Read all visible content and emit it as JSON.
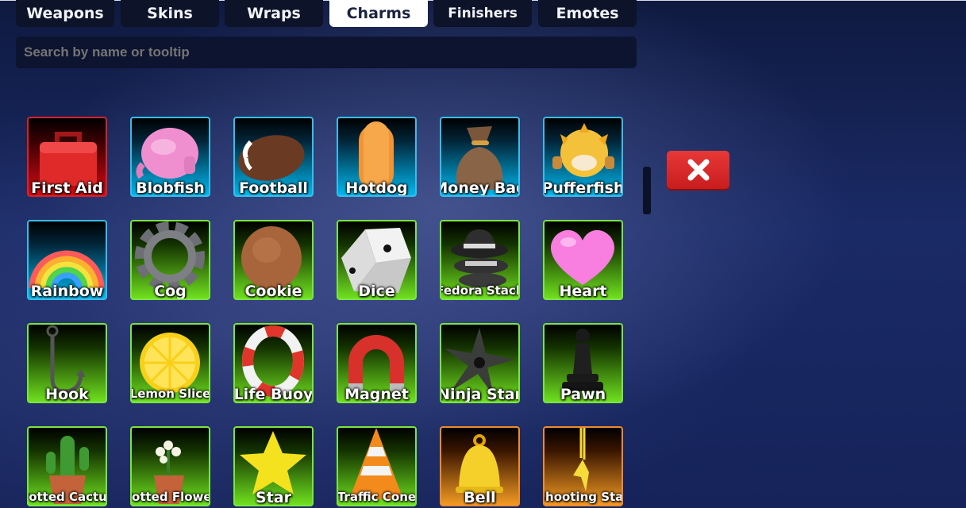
{
  "tabs": [
    {
      "label": "Weapons",
      "active": false
    },
    {
      "label": "Skins",
      "active": false
    },
    {
      "label": "Wraps",
      "active": false
    },
    {
      "label": "Charms",
      "active": true
    },
    {
      "label": "Finishers",
      "active": false
    },
    {
      "label": "Emotes",
      "active": false
    }
  ],
  "search": {
    "placeholder": "Search by name or tooltip"
  },
  "items": [
    {
      "name": "First Aid",
      "rarity": "red",
      "icon": "first-aid-icon"
    },
    {
      "name": "Blobfish",
      "rarity": "blue",
      "icon": "blobfish-icon"
    },
    {
      "name": "Football",
      "rarity": "blue",
      "icon": "football-icon"
    },
    {
      "name": "Hotdog",
      "rarity": "blue",
      "icon": "hotdog-icon"
    },
    {
      "name": "Money Bag",
      "rarity": "blue",
      "icon": "money-bag-icon"
    },
    {
      "name": "Pufferfish",
      "rarity": "blue",
      "icon": "pufferfish-icon"
    },
    {
      "name": "Rainbow",
      "rarity": "blue",
      "icon": "rainbow-icon"
    },
    {
      "name": "Cog",
      "rarity": "green",
      "icon": "cog-icon"
    },
    {
      "name": "Cookie",
      "rarity": "green",
      "icon": "cookie-icon"
    },
    {
      "name": "Dice",
      "rarity": "green",
      "icon": "dice-icon"
    },
    {
      "name": "Fedora Stack",
      "rarity": "green",
      "icon": "fedora-stack-icon"
    },
    {
      "name": "Heart",
      "rarity": "green",
      "icon": "heart-icon"
    },
    {
      "name": "Hook",
      "rarity": "green",
      "icon": "hook-icon"
    },
    {
      "name": "Lemon Slice",
      "rarity": "green",
      "icon": "lemon-slice-icon"
    },
    {
      "name": "Life Buoy",
      "rarity": "green",
      "icon": "life-buoy-icon"
    },
    {
      "name": "Magnet",
      "rarity": "green",
      "icon": "magnet-icon"
    },
    {
      "name": "Ninja Star",
      "rarity": "green",
      "icon": "ninja-star-icon"
    },
    {
      "name": "Pawn",
      "rarity": "green",
      "icon": "pawn-icon"
    },
    {
      "name": "Potted Cactus",
      "rarity": "green",
      "icon": "potted-cactus-icon"
    },
    {
      "name": "Potted Flower",
      "rarity": "green",
      "icon": "potted-flower-icon"
    },
    {
      "name": "Star",
      "rarity": "green",
      "icon": "star-icon"
    },
    {
      "name": "Traffic Cone",
      "rarity": "green",
      "icon": "traffic-cone-icon"
    },
    {
      "name": "Bell",
      "rarity": "orange",
      "icon": "bell-icon"
    },
    {
      "name": "Shooting Star",
      "rarity": "orange",
      "icon": "shooting-star-icon"
    }
  ],
  "close_button": {
    "icon": "close-icon"
  }
}
